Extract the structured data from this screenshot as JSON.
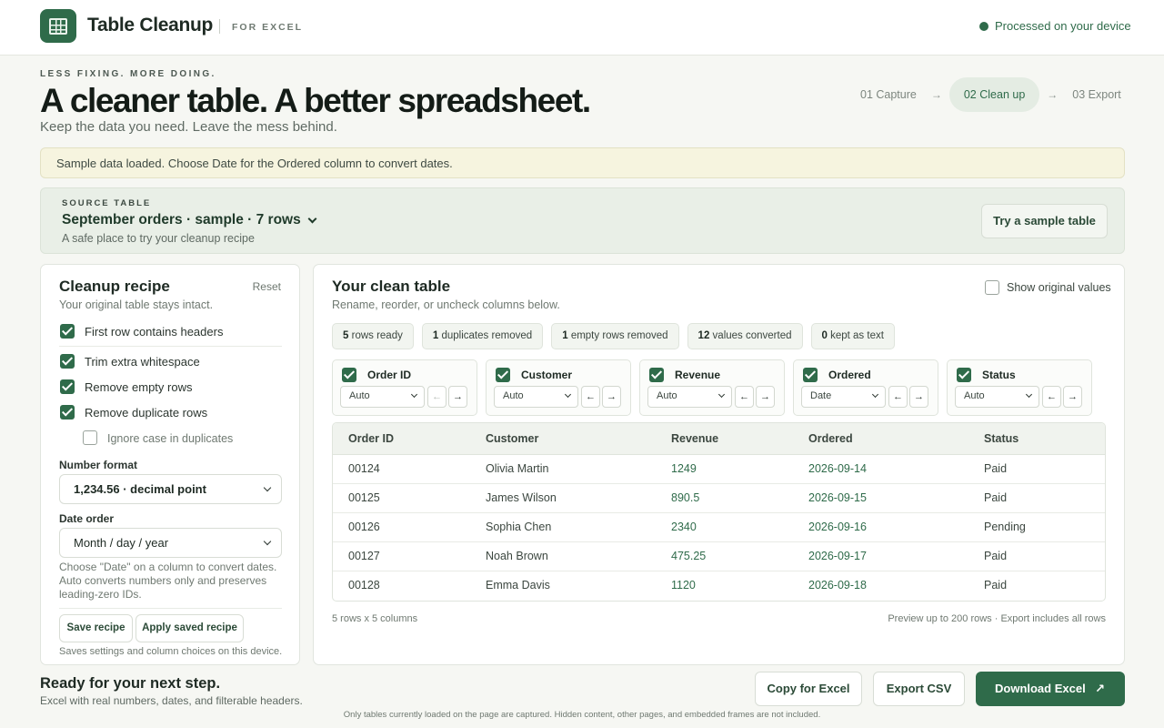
{
  "app": {
    "title": "Table Cleanup",
    "subtitle": "FOR EXCEL",
    "status": "Processed on your device",
    "accent": "#2f6b4a"
  },
  "hero": {
    "eyebrow": "LESS FIXING. MORE DOING.",
    "title": "A cleaner table. A better spreadsheet.",
    "subtitle": "Keep the data you need. Leave the mess behind."
  },
  "steps": [
    "01 Capture",
    "02 Clean up",
    "03 Export"
  ],
  "steps_arrow": "→",
  "active_step": "02 Clean up",
  "notice": "Sample data loaded. Choose Date for the Ordered column to convert dates.",
  "source": {
    "eyebrow": "SOURCE TABLE",
    "title": "September orders · sample · 7 rows",
    "subtitle": "A safe place to try your cleanup recipe",
    "sample_button": "Try a sample table"
  },
  "recipe": {
    "title": "Cleanup recipe",
    "reset": "Reset",
    "subtitle": "Your original table stays intact.",
    "options": [
      {
        "label": "First row contains headers",
        "checked": true
      },
      {
        "label": "Trim extra whitespace",
        "checked": true
      },
      {
        "label": "Remove empty rows",
        "checked": true
      },
      {
        "label": "Remove duplicate rows",
        "checked": true
      },
      {
        "label": "Ignore case in duplicates",
        "checked": false
      }
    ],
    "number_format_label": "Number format",
    "number_format_value": "1,234.56 · decimal point",
    "date_order_label": "Date order",
    "date_order_value": "Month / day / year",
    "hint": "Choose \"Date\" on a column to convert dates. Auto converts numbers only and preserves leading-zero IDs.",
    "save_button": "Save recipe",
    "apply_button": "Apply saved recipe",
    "saves_note": "Saves settings and column choices on this device."
  },
  "clean": {
    "title": "Your clean table",
    "subtitle": "Rename, reorder, or uncheck columns below.",
    "show_original": "Show original values",
    "chips": [
      {
        "count": "5",
        "label": "rows ready"
      },
      {
        "count": "1",
        "label": "duplicates removed"
      },
      {
        "count": "1",
        "label": "empty rows removed"
      },
      {
        "count": "12",
        "label": "values converted"
      },
      {
        "count": "0",
        "label": "kept as text"
      }
    ],
    "columns": [
      {
        "name": "Order ID",
        "type": "Auto"
      },
      {
        "name": "Customer",
        "type": "Auto"
      },
      {
        "name": "Revenue",
        "type": "Auto"
      },
      {
        "name": "Ordered",
        "type": "Date"
      },
      {
        "name": "Status",
        "type": "Auto"
      }
    ],
    "arrow_left": "←",
    "arrow_right": "→",
    "headers": [
      "Order ID",
      "Customer",
      "Revenue",
      "Ordered",
      "Status"
    ],
    "rows": [
      [
        "00124",
        "Olivia Martin",
        "1249",
        "2026-09-14",
        "Paid"
      ],
      [
        "00125",
        "James Wilson",
        "890.5",
        "2026-09-15",
        "Paid"
      ],
      [
        "00126",
        "Sophia Chen",
        "2340",
        "2026-09-16",
        "Pending"
      ],
      [
        "00127",
        "Noah Brown",
        "475.25",
        "2026-09-17",
        "Paid"
      ],
      [
        "00128",
        "Emma Davis",
        "1120",
        "2026-09-18",
        "Paid"
      ]
    ],
    "footer_left": "5 rows x 5 columns",
    "footer_right": "Preview up to 200 rows · Export includes all rows"
  },
  "bottom": {
    "title": "Ready for your next step.",
    "subtitle": "Excel with real numbers, dates, and filterable headers.",
    "copy_button": "Copy for Excel",
    "csv_button": "Export CSV",
    "download_button": "Download Excel",
    "download_icon": "↗",
    "fineprint": "Only tables currently loaded on the page are captured. Hidden content, other pages, and embedded frames are not included."
  }
}
